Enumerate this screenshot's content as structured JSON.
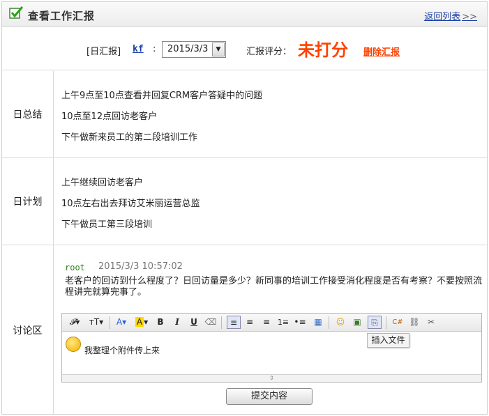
{
  "header": {
    "title": "查看工作汇报",
    "back_link": "返回列表",
    "back_arrows": ">>"
  },
  "topbar": {
    "type_label": "[日汇报]",
    "user": "kf",
    "colon": ":",
    "date_select": "2015/3/3",
    "score_label": "汇报评分：",
    "score_value": "未打分",
    "delete_link": "删除汇报"
  },
  "summary": {
    "label": "日总结",
    "lines": [
      "上午9点至10点查看并回复CRM客户答疑中的问题",
      "10点至12点回访老客户",
      "下午做新来员工的第二段培训工作"
    ]
  },
  "plan": {
    "label": "日计划",
    "lines": [
      "上午继续回访老客户",
      "10点左右出去拜访艾米丽运营总监",
      "下午做员工第三段培训"
    ]
  },
  "discussion": {
    "label": "讨论区",
    "comment_user": "root",
    "comment_time": "2015/3/3 10:57:02",
    "comment_text": "老客户的回访到什么程度了？日回访量是多少？新同事的培训工作接受消化程度是否有考察？不要按照流程讲完就算完事了。",
    "editor_text": "我整理个附件传上来",
    "tooltip": "插入文件",
    "submit_label": "提交内容"
  },
  "colors": {
    "accent": "#ff4200",
    "link": "#1a3ea8",
    "user": "#2e7d1e"
  }
}
